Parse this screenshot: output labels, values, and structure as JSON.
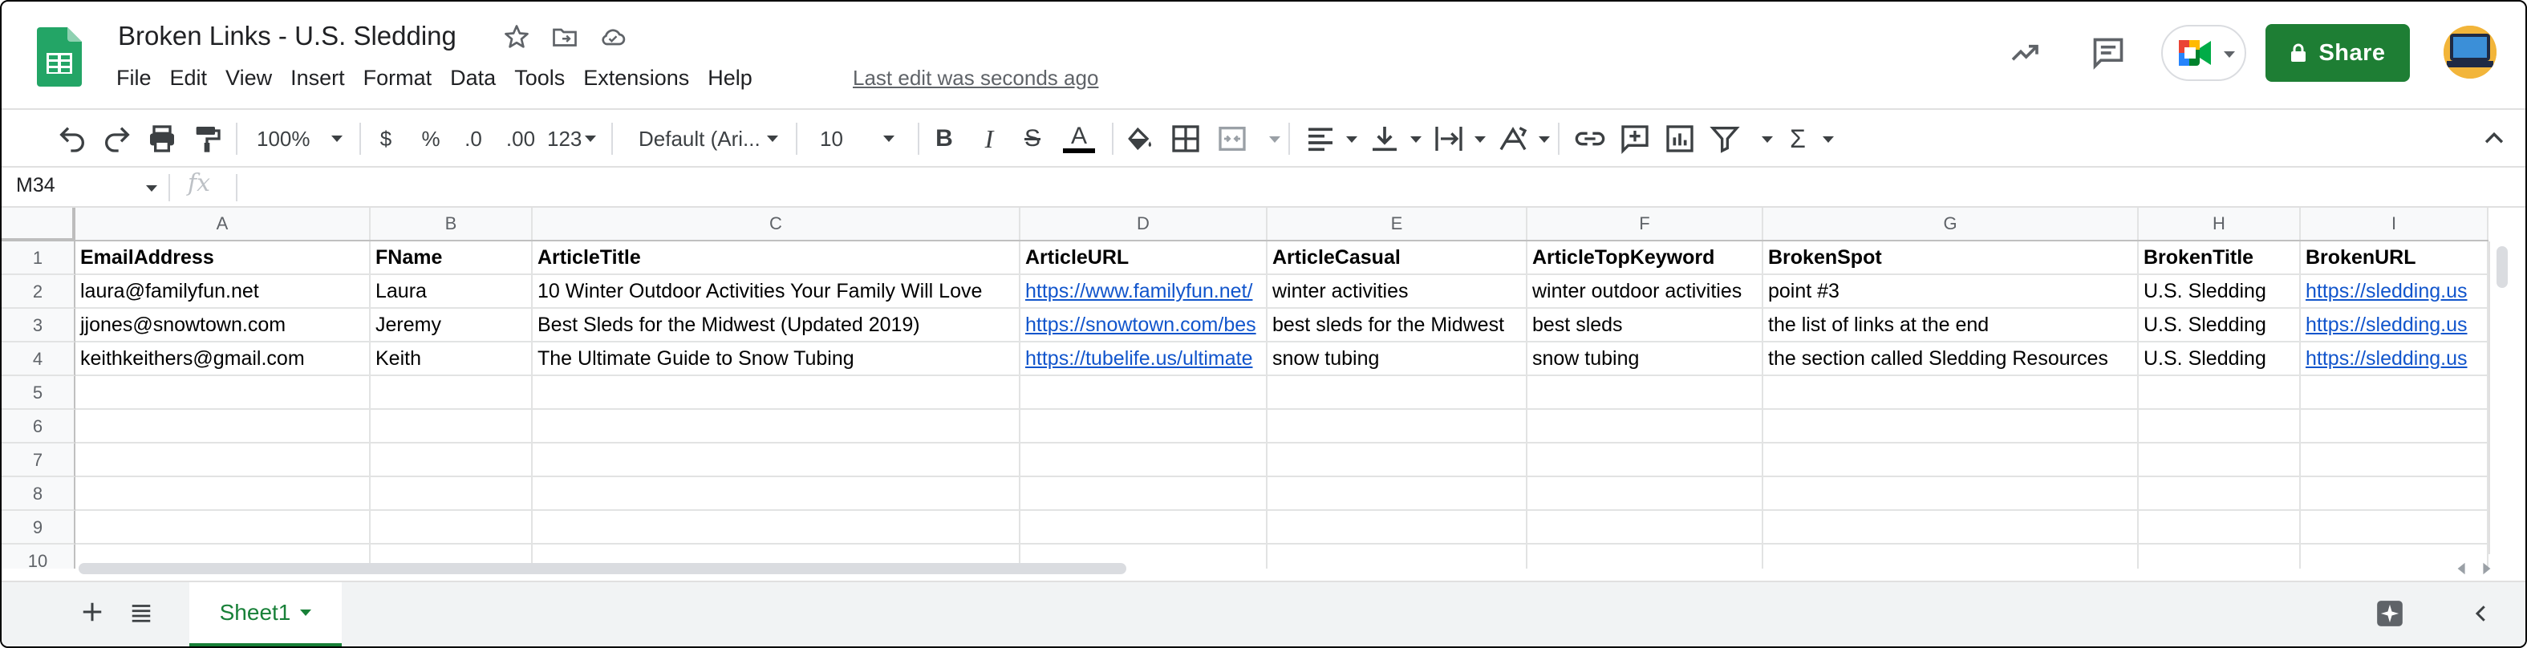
{
  "app": {
    "doc_title": "Broken Links - U.S. Sledding",
    "last_edit": "Last edit was seconds ago",
    "share_label": "Share"
  },
  "menu": [
    "File",
    "Edit",
    "View",
    "Insert",
    "Format",
    "Data",
    "Tools",
    "Extensions",
    "Help"
  ],
  "toolbar": {
    "zoom": "100%",
    "currency": "$",
    "percent": "%",
    "dec_decrease": ".0",
    "dec_increase": ".00",
    "number_format": "123",
    "font": "Default (Ari...",
    "font_size": "10",
    "bold": "B",
    "italic": "I",
    "strike": "S",
    "text_color_glyph": "A",
    "text_color": "#000000",
    "functions": "Σ"
  },
  "formula_bar": {
    "name_box": "M34",
    "fx_label": "fx"
  },
  "grid": {
    "columns": [
      "A",
      "B",
      "C",
      "D",
      "E",
      "F",
      "G",
      "H",
      "I"
    ],
    "row_numbers": [
      "1",
      "2",
      "3",
      "4",
      "5",
      "6",
      "7",
      "8",
      "9",
      "10"
    ],
    "rows": [
      [
        "EmailAddress",
        "FName",
        "ArticleTitle",
        "ArticleURL",
        "ArticleCasual",
        "ArticleTopKeyword",
        "BrokenSpot",
        "BrokenTitle",
        "BrokenURL"
      ],
      [
        "laura@familyfun.net",
        "Laura",
        "10 Winter Outdoor Activities Your Family Will Love",
        "https://www.familyfun.net/",
        "winter activities",
        "winter outdoor activities",
        "point #3",
        "U.S. Sledding",
        "https://sledding.us"
      ],
      [
        "jjones@snowtown.com",
        "Jeremy",
        "Best Sleds for the Midwest (Updated 2019)",
        "https://snowtown.com/bes",
        "best sleds for the Midwest",
        "best sleds",
        "the list of links at the end",
        "U.S. Sledding",
        "https://sledding.us"
      ],
      [
        "keithkeithers@gmail.com",
        "Keith",
        "The Ultimate Guide to Snow Tubing",
        "https://tubelife.us/ultimate",
        "snow tubing",
        "snow tubing",
        "the section called Sledding Resources",
        "U.S. Sledding",
        "https://sledding.us"
      ]
    ],
    "link_columns": [
      3,
      8
    ]
  },
  "sheets": {
    "active": "Sheet1"
  },
  "colors": {
    "brand_green": "#1e7e34",
    "link": "#1155cc",
    "header_bg": "#f8f9fa"
  },
  "icons": [
    "sheets-logo-icon",
    "star-icon",
    "move-folder-icon",
    "cloud-saved-icon",
    "trend-icon",
    "comment-icon",
    "meet-icon",
    "lock-icon",
    "undo-icon",
    "redo-icon",
    "print-icon",
    "paint-format-icon",
    "fill-color-icon",
    "borders-icon",
    "merge-icon",
    "align-icon",
    "valign-icon",
    "wrap-icon",
    "rotate-icon",
    "link-icon",
    "comment-add-icon",
    "chart-icon",
    "filter-icon",
    "collapse-icon",
    "add-sheet-icon",
    "all-sheets-icon",
    "explore-icon",
    "side-panel-icon"
  ]
}
